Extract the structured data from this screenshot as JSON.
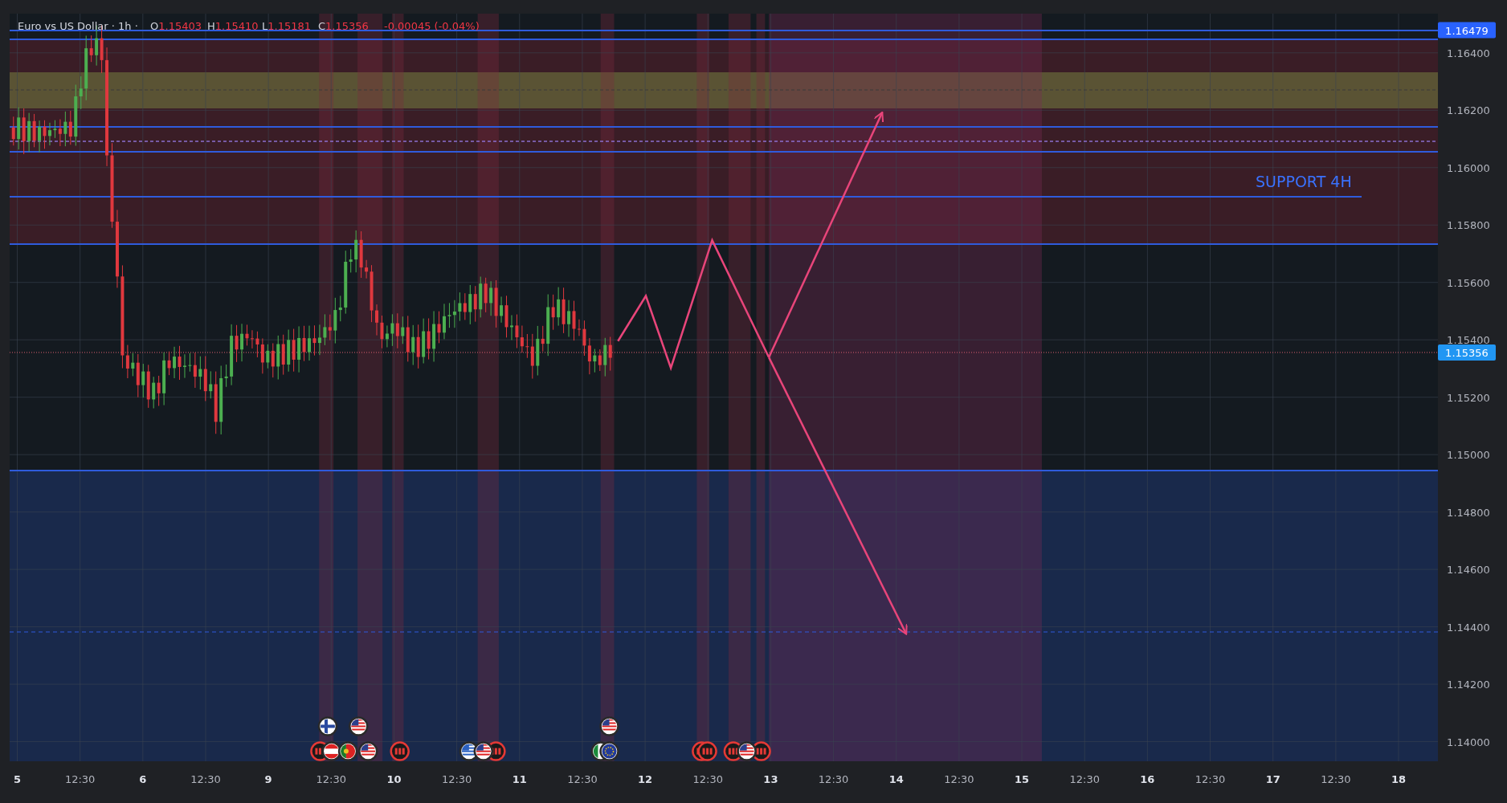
{
  "header": {
    "title": "Euro vs US Dollar · 1h ·",
    "ohlc": [
      {
        "label": "O",
        "value": "1.15403"
      },
      {
        "label": "H",
        "value": "1.15410"
      },
      {
        "label": "L",
        "value": "1.15181"
      },
      {
        "label": "C",
        "value": "1.15356"
      }
    ],
    "change": "-0.00045 (-0.04%)"
  },
  "annotation": "SUPPORT 4H",
  "price_axis": {
    "ticks": [
      "1.16400",
      "1.16200",
      "1.16000",
      "1.15800",
      "1.15600",
      "1.15400",
      "1.15200",
      "1.15000",
      "1.14800",
      "1.14600",
      "1.14400",
      "1.14200",
      "1.14000"
    ],
    "top_marker": "1.16479",
    "last_price": "1.15356"
  },
  "time_axis": [
    {
      "label": "5",
      "kind": "day"
    },
    {
      "label": "12:30",
      "kind": "time"
    },
    {
      "label": "6",
      "kind": "day"
    },
    {
      "label": "12:30",
      "kind": "time"
    },
    {
      "label": "9",
      "kind": "day"
    },
    {
      "label": "12:30",
      "kind": "time"
    },
    {
      "label": "10",
      "kind": "day"
    },
    {
      "label": "12:30",
      "kind": "time"
    },
    {
      "label": "11",
      "kind": "day"
    },
    {
      "label": "12:30",
      "kind": "time"
    },
    {
      "label": "12",
      "kind": "day"
    },
    {
      "label": "12:30",
      "kind": "time"
    },
    {
      "label": "13",
      "kind": "day"
    },
    {
      "label": "12:30",
      "kind": "time"
    },
    {
      "label": "14",
      "kind": "day"
    },
    {
      "label": "12:30",
      "kind": "time"
    },
    {
      "label": "15",
      "kind": "day"
    },
    {
      "label": "12:30",
      "kind": "time"
    },
    {
      "label": "16",
      "kind": "day"
    },
    {
      "label": "12:30",
      "kind": "time"
    },
    {
      "label": "17",
      "kind": "day"
    },
    {
      "label": "12:30",
      "kind": "time"
    },
    {
      "label": "18",
      "kind": "day"
    }
  ]
}
